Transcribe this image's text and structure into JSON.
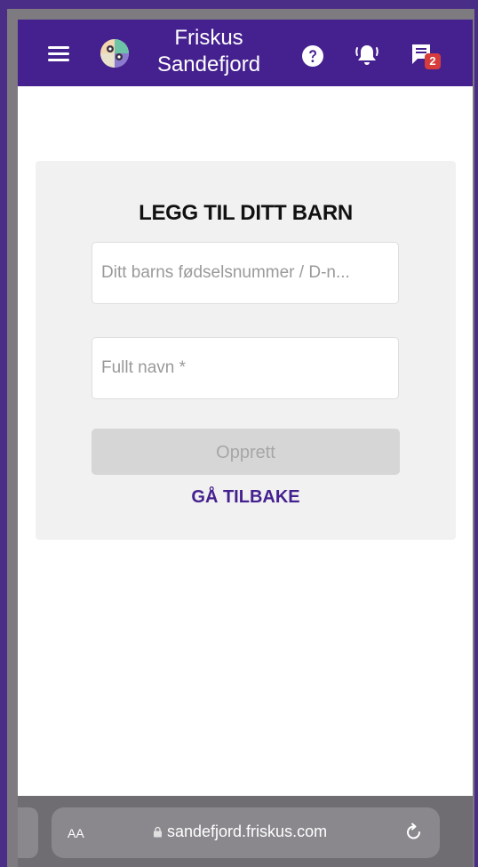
{
  "header": {
    "title_line1": "Friskus",
    "title_line2": "Sandefjord",
    "notifications_badge": "2",
    "brand_color": "#45218f"
  },
  "form": {
    "title": "LEGG TIL DITT BARN",
    "id_field_placeholder": "Ditt barns fødselsnummer / D-n...",
    "name_field_placeholder": "Fullt navn *",
    "submit_label": "Opprett",
    "back_label": "GÅ TILBAKE"
  },
  "browser": {
    "text_size_label": "AA",
    "url": "sandefjord.friskus.com"
  },
  "icons": {
    "menu": "hamburger-menu-icon",
    "logo": "friskus-logo",
    "help": "help-icon",
    "bell": "bell-icon",
    "chat": "chat-icon",
    "lock": "lock-icon",
    "reload": "reload-icon"
  }
}
